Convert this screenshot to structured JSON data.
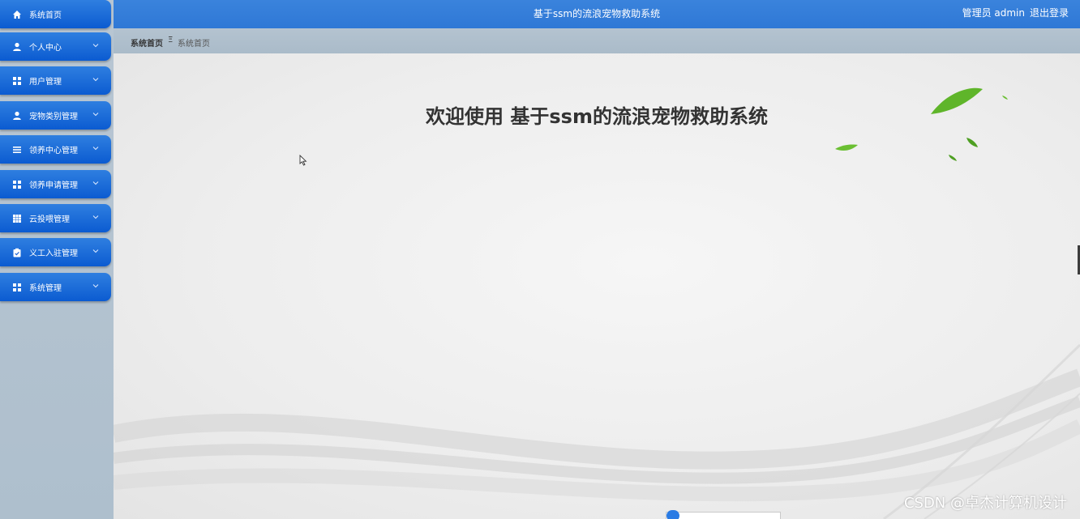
{
  "sidebar": {
    "items": [
      {
        "label": "系统首页",
        "icon": "home-icon",
        "has_chevron": false
      },
      {
        "label": "个人中心",
        "icon": "person-icon",
        "has_chevron": true
      },
      {
        "label": "用户管理",
        "icon": "grid-icon",
        "has_chevron": true
      },
      {
        "label": "宠物类别管理",
        "icon": "person-icon",
        "has_chevron": true
      },
      {
        "label": "领养中心管理",
        "icon": "list-icon",
        "has_chevron": true
      },
      {
        "label": "领养申请管理",
        "icon": "grid-icon",
        "has_chevron": true
      },
      {
        "label": "云投喂管理",
        "icon": "table-icon",
        "has_chevron": true
      },
      {
        "label": "义工入驻管理",
        "icon": "clipboard-icon",
        "has_chevron": true
      },
      {
        "label": "系统管理",
        "icon": "grid-icon",
        "has_chevron": true
      }
    ]
  },
  "header": {
    "title": "基于ssm的流浪宠物救助系统",
    "user_label": "管理员 admin",
    "logout_label": "退出登录"
  },
  "breadcrumb": {
    "home": "系统首页",
    "separator": "Ξ",
    "current": "系统首页"
  },
  "main": {
    "welcome": "欢迎使用 基于ssm的流浪宠物救助系统"
  },
  "watermark": "CSDN @卓杰计算机设计",
  "colors": {
    "accent": "#2f78d6",
    "menu_top": "#2f7fe0",
    "menu_bottom": "#0b5bd1",
    "leaf_green": "#5fb52a"
  }
}
